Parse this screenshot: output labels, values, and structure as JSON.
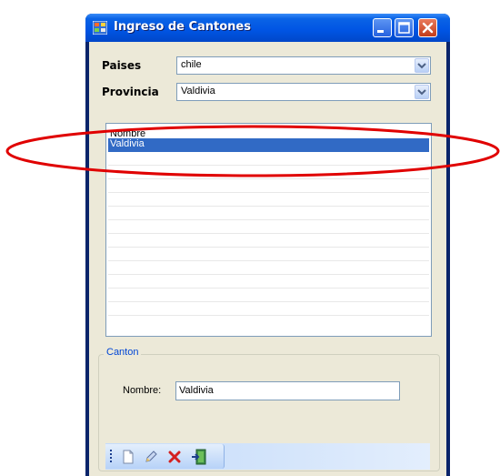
{
  "window": {
    "title": "Ingreso de Cantones"
  },
  "form": {
    "paises_label": "Paises",
    "paises_value": "chile",
    "provincia_label": "Provincia",
    "provincia_value": "Valdivia"
  },
  "grid": {
    "header": "Nombre",
    "rows": [
      "Valdivia"
    ]
  },
  "canton_group": {
    "legend": "Canton",
    "nombre_label": "Nombre:",
    "nombre_value": "Valdivia"
  },
  "toolbar": {
    "icons": [
      "new-document-icon",
      "edit-pencil-icon",
      "delete-x-icon",
      "exit-door-icon"
    ]
  },
  "colors": {
    "titlebar": "#0054e3",
    "selection": "#316ac5",
    "annotation": "#e00000",
    "group_legend": "#0046d5"
  }
}
